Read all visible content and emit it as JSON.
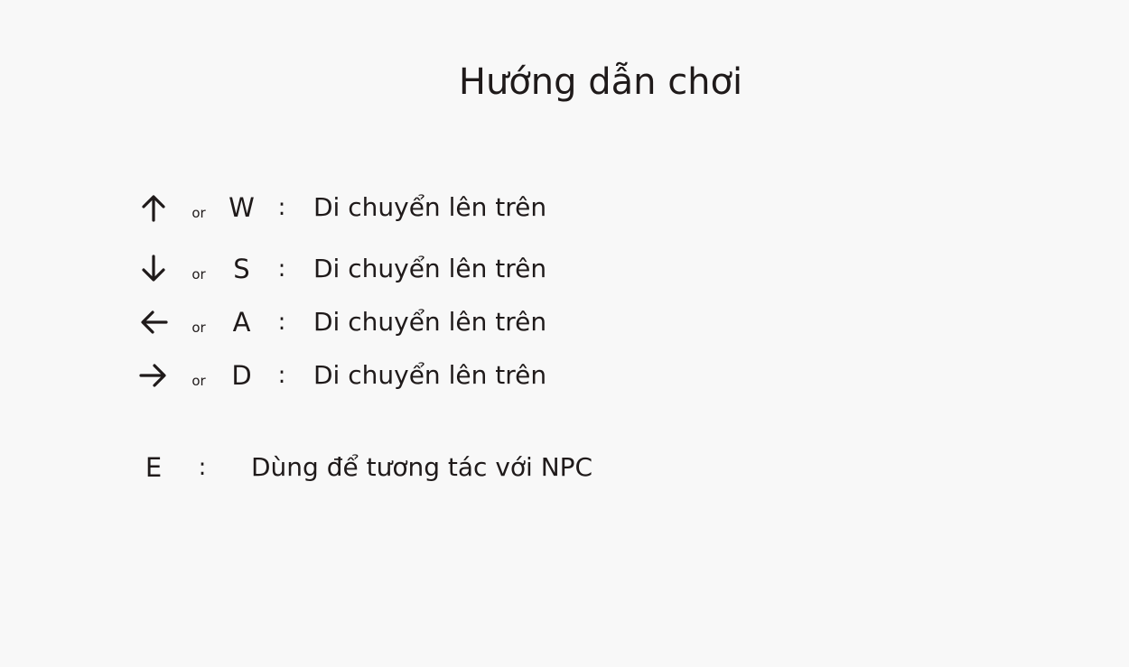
{
  "title": "Hướng dẫn chơi",
  "controls": [
    {
      "icon": "arrow-up-icon",
      "or": "or",
      "key": "W",
      "separator": ":",
      "description": "Di chuyển lên trên"
    },
    {
      "icon": "arrow-down-icon",
      "or": "or",
      "key": "S",
      "separator": ":",
      "description": "Di chuyển lên trên"
    },
    {
      "icon": "arrow-left-icon",
      "or": "or",
      "key": "A",
      "separator": ":",
      "description": "Di chuyển lên trên"
    },
    {
      "icon": "arrow-right-icon",
      "or": "or",
      "key": "D",
      "separator": ":",
      "description": "Di chuyển lên trên"
    }
  ],
  "interact": {
    "key": "E",
    "separator": ":",
    "description": "Dùng để tương tác với NPC"
  },
  "colors": {
    "background": "#f8f8f8",
    "text": "#1f1a1a"
  }
}
